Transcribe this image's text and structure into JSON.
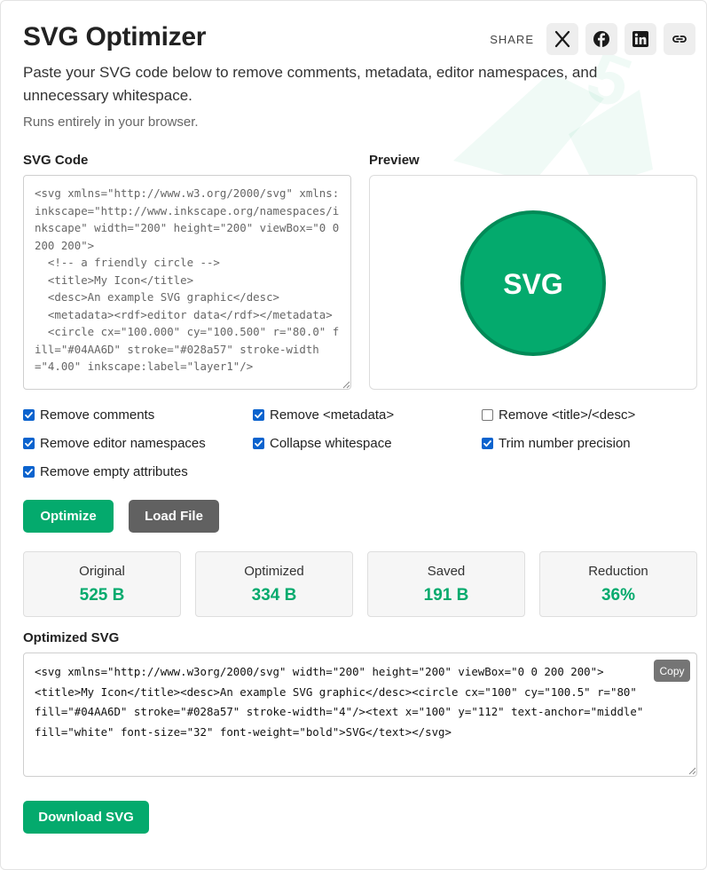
{
  "header": {
    "title": "SVG Optimizer",
    "share_label": "SHARE",
    "share_buttons": [
      {
        "icon": "x-twitter-icon"
      },
      {
        "icon": "facebook-icon"
      },
      {
        "icon": "linkedin-icon"
      },
      {
        "icon": "link-icon"
      }
    ]
  },
  "intro": {
    "description": "Paste your SVG code below to remove comments, metadata, editor namespaces, and unnecessary whitespace.",
    "note": "Runs entirely in your browser."
  },
  "input": {
    "label": "SVG Code",
    "value": "<svg xmlns=\"http://www.w3.org/2000/svg\" xmlns:inkscape=\"http://www.inkscape.org/namespaces/inkscape\" width=\"200\" height=\"200\" viewBox=\"0 0 200 200\">\n  <!-- a friendly circle -->\n  <title>My Icon</title>\n  <desc>An example SVG graphic</desc>\n  <metadata><rdf>editor data</rdf></metadata>\n  <circle cx=\"100.000\" cy=\"100.500\" r=\"80.0\" fill=\"#04AA6D\" stroke=\"#028a57\" stroke-width=\"4.00\" inkscape:label=\"layer1\"/>"
  },
  "preview": {
    "label": "Preview",
    "circle_text": "SVG",
    "fill": "#04AA6D",
    "stroke": "#028a57"
  },
  "options": [
    {
      "label": "Remove comments",
      "checked": true
    },
    {
      "label": "Remove <metadata>",
      "checked": true
    },
    {
      "label": "Remove <title>/<desc>",
      "checked": false
    },
    {
      "label": "Remove editor namespaces",
      "checked": true
    },
    {
      "label": "Collapse whitespace",
      "checked": true
    },
    {
      "label": "Trim number precision",
      "checked": true
    },
    {
      "label": "Remove empty attributes",
      "checked": true
    }
  ],
  "actions": {
    "optimize": "Optimize",
    "load_file": "Load File"
  },
  "stats": [
    {
      "label": "Original",
      "value": "525 B"
    },
    {
      "label": "Optimized",
      "value": "334 B"
    },
    {
      "label": "Saved",
      "value": "191 B"
    },
    {
      "label": "Reduction",
      "value": "36%"
    }
  ],
  "output": {
    "label": "Optimized SVG",
    "value": "<svg xmlns=\"http://www.w3org/2000/svg\" width=\"200\" height=\"200\" viewBox=\"0 0 200 200\">\n<title>My Icon</title><desc>An example SVG graphic</desc><circle cx=\"100\" cy=\"100.5\" r=\"80\"\nfill=\"#04AA6D\" stroke=\"#028a57\" stroke-width=\"4\"/><text x=\"100\" y=\"112\" text-anchor=\"middle\"\nfill=\"white\" font-size=\"32\" font-weight=\"bold\">SVG</text></svg>",
    "copy_label": "Copy",
    "download_label": "Download SVG"
  },
  "colors": {
    "accent": "#04AA6D",
    "secondary_button": "#616161",
    "checkbox": "#0B63CE"
  }
}
